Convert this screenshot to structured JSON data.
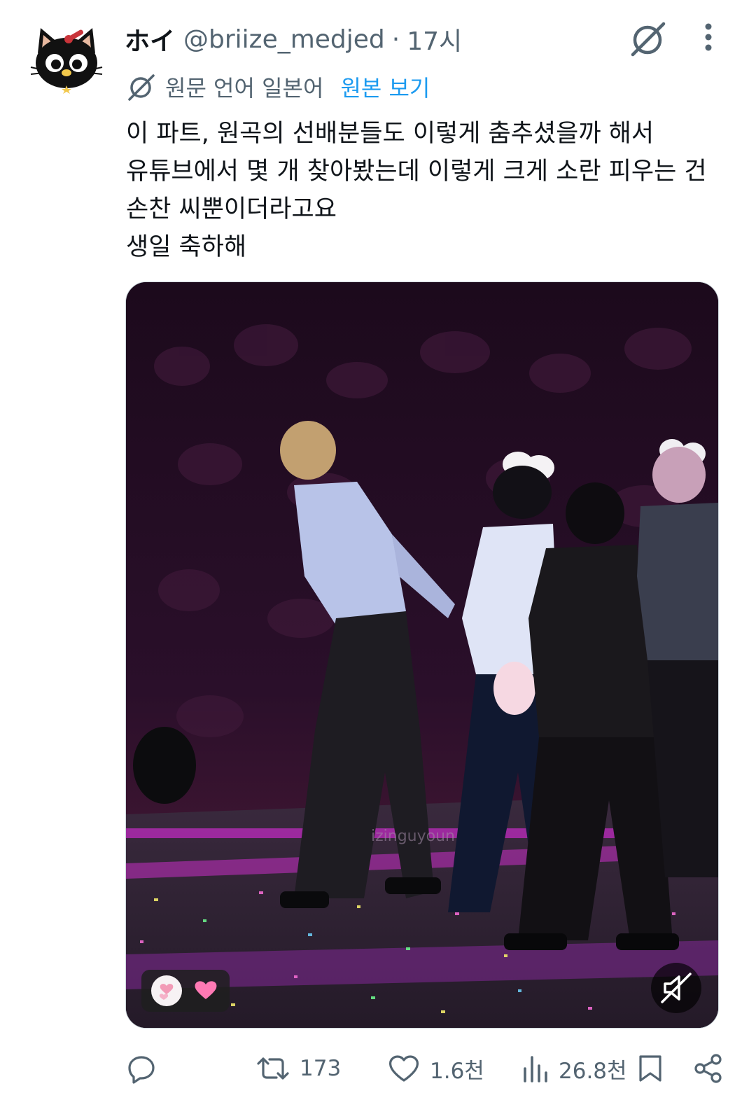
{
  "post": {
    "display_name": "ホイ",
    "handle": "@briize_medjed",
    "separator": "·",
    "time": "17시",
    "translation_label": "원문 언어 일본어",
    "show_original": "원본 보기",
    "text_lines": [
      "이 파트, 원곡의 선배분들도 이렇게 춤추셨을까 해서",
      "유튜브에서 몇 개 찾아봤는데 이렇게 크게 소란 피우는 건",
      "손찬 씨뿐이더라고요",
      "생일 축하해"
    ],
    "media": {
      "type": "video",
      "watermark": "izingu...",
      "muted": true,
      "reaction_icons": [
        "heart-balloon-icon",
        "pink-heart-icon"
      ]
    }
  },
  "actions": {
    "reply": {
      "icon": "reply-icon",
      "count": ""
    },
    "repost": {
      "icon": "repost-icon",
      "count": "173"
    },
    "like": {
      "icon": "heart-icon",
      "count": "1.6천"
    },
    "views": {
      "icon": "views-icon",
      "count": "26.8천"
    },
    "bookmark": {
      "icon": "bookmark-icon"
    },
    "share": {
      "icon": "share-icon"
    }
  },
  "colors": {
    "text": "#0f1419",
    "secondary": "#536471",
    "link": "#1d9bf0",
    "heart_pink": "#ff6fa8"
  }
}
